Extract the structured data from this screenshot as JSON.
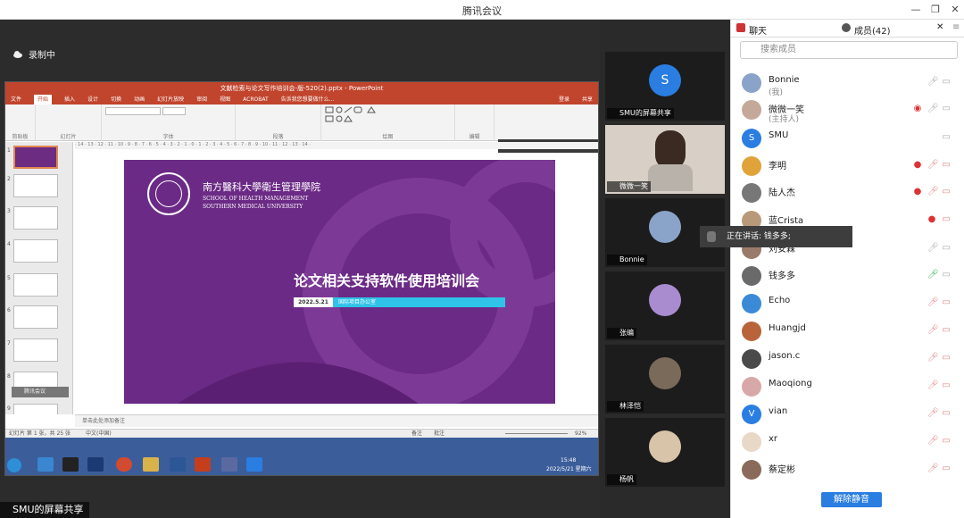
{
  "window": {
    "title": "腾讯会议",
    "minimize": "—",
    "restore": "❐",
    "close": "✕"
  },
  "recording": {
    "label": "录制中"
  },
  "ppt": {
    "title": "文献检索与论文写作培训会-版-520(2).pptx - PowerPoint",
    "tabs": [
      "文件",
      "开始",
      "插入",
      "设计",
      "切换",
      "动画",
      "幻灯片放映",
      "审阅",
      "视图",
      "ACROBAT",
      "告诉我您想要做什么..."
    ],
    "active_tab": "开始",
    "login": "登录",
    "share": "共享",
    "ribbon_groups": [
      "剪贴板",
      "幻灯片",
      "字体",
      "段落",
      "绘图",
      "编辑"
    ],
    "speaking_popup": "正在讲话: 钱多多;",
    "slide": {
      "school_cn": "南方醫科大學衛生管理學院",
      "school_en1": "SCHOOL OF HEALTH MANAGEMENT",
      "school_en2": "SOUTHERN MEDICAL UNIVERSITY",
      "title": "论文相关支持软件使用培训会",
      "date": "2022.5.21",
      "dept": "国际项目办公室"
    },
    "notes": "单击此处添加备注",
    "status_left": "幻灯片 第 1 张，共 25 张",
    "status_lang": "中文(中国)",
    "status_notes": "备注",
    "status_comments": "批注",
    "zoom": "92%",
    "clock_time": "15:48",
    "clock_date": "2022/5/21 星期六",
    "float_label": "腾讯会议",
    "thumb_numbers": [
      "1",
      "2",
      "3",
      "4",
      "5",
      "6",
      "7",
      "8",
      "9"
    ]
  },
  "share_badge": "SMU的屏幕共享",
  "tiles": [
    {
      "label": "SMU的屏幕共享",
      "avatar": "S"
    },
    {
      "label": "微微一笑"
    },
    {
      "label": "Bonnie"
    },
    {
      "label": "张编"
    },
    {
      "label": "林泽恺"
    },
    {
      "label": "杨帆"
    }
  ],
  "panel": {
    "tab_chat": "聊天",
    "tab_members": "成员(42)",
    "search_placeholder": "搜索成员",
    "members": [
      {
        "name": "Bonnie",
        "sub": "(我)",
        "color": "#8aa3c8"
      },
      {
        "name": "微微一笑",
        "sub": "(主持人)",
        "color": "#c4a99a"
      },
      {
        "name": "SMU",
        "sub": "",
        "color": "#2a7de1",
        "letter": "S"
      },
      {
        "name": "李明",
        "sub": "",
        "color": "#e0a33a"
      },
      {
        "name": "陆人杰",
        "sub": "",
        "color": "#777777"
      },
      {
        "name": "蓝Crista",
        "sub": "",
        "color": "#b89a7a"
      },
      {
        "name": "刘安霖",
        "sub": "",
        "color": "#9a7a6a"
      },
      {
        "name": "钱多多",
        "sub": "",
        "color": "#6a6a6a"
      },
      {
        "name": "Echo",
        "sub": "",
        "color": "#3a8ad8"
      },
      {
        "name": "Huangjd",
        "sub": "",
        "color": "#b8633a"
      },
      {
        "name": "jason.c",
        "sub": "",
        "color": "#4a4a4a"
      },
      {
        "name": "Maoqiong",
        "sub": "",
        "color": "#d8a8a8"
      },
      {
        "name": "vian",
        "sub": "",
        "color": "#2a7de1",
        "letter": "V"
      },
      {
        "name": "xr",
        "sub": "",
        "color": "#e8d8c8"
      },
      {
        "name": "蔡定彬",
        "sub": "",
        "color": "#8a6a5a"
      }
    ],
    "unmute_button": "解除静音"
  },
  "speaking_float": "正在讲话: 钱多多;"
}
